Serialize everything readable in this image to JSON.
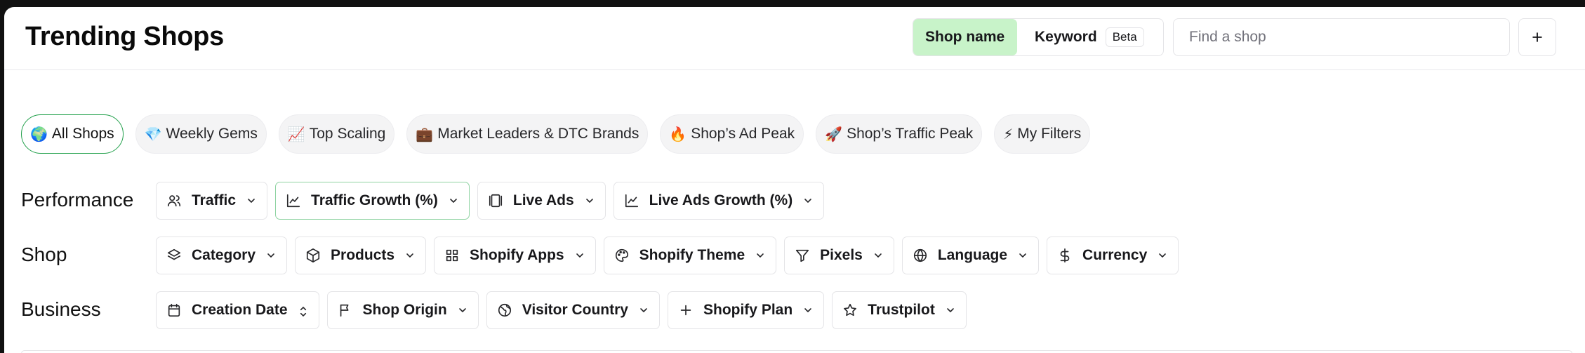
{
  "header": {
    "title": "Trending Shops",
    "search_mode": {
      "shop_name": "Shop name",
      "keyword": "Keyword",
      "beta_badge": "Beta"
    },
    "search": {
      "placeholder": "Find a shop",
      "value": ""
    },
    "add_icon": "plus-icon"
  },
  "presets": [
    {
      "emoji": "🌍",
      "label": "All Shops",
      "active": true
    },
    {
      "emoji": "💎",
      "label": "Weekly Gems"
    },
    {
      "emoji": "📈",
      "label": "Top Scaling"
    },
    {
      "emoji": "💼",
      "label": "Market Leaders & DTC Brands"
    },
    {
      "emoji": "🔥",
      "label": "Shop’s Ad Peak"
    },
    {
      "emoji": "🚀",
      "label": "Shop’s Traffic Peak"
    },
    {
      "emoji": "⚡",
      "label": "My Filters"
    }
  ],
  "rows": {
    "performance": {
      "label": "Performance",
      "filters": [
        {
          "label": "Traffic",
          "icon": "users-icon"
        },
        {
          "label": "Traffic Growth (%)",
          "icon": "line-chart-icon",
          "active": true
        },
        {
          "label": "Live Ads",
          "icon": "gallery-icon"
        },
        {
          "label": "Live Ads Growth (%)",
          "icon": "line-chart-icon"
        }
      ]
    },
    "shop": {
      "label": "Shop",
      "filters": [
        {
          "label": "Category",
          "icon": "layers-icon"
        },
        {
          "label": "Products",
          "icon": "box-icon"
        },
        {
          "label": "Shopify Apps",
          "icon": "grid-icon"
        },
        {
          "label": "Shopify Theme",
          "icon": "palette-icon"
        },
        {
          "label": "Pixels",
          "icon": "filter-icon"
        },
        {
          "label": "Language",
          "icon": "globe-icon"
        },
        {
          "label": "Currency",
          "icon": "dollar-icon"
        }
      ]
    },
    "business": {
      "label": "Business",
      "filters": [
        {
          "label": "Creation Date",
          "icon": "calendar-icon",
          "sort": true
        },
        {
          "label": "Shop Origin",
          "icon": "flag-icon"
        },
        {
          "label": "Visitor Country",
          "icon": "earth-icon"
        },
        {
          "label": "Shopify Plan",
          "icon": "plus-icon"
        },
        {
          "label": "Trustpilot",
          "icon": "star-icon"
        }
      ]
    }
  },
  "colors": {
    "active_segment": "#c8f3c9",
    "active_pill_border": "#22a04b",
    "active_filter_border": "#8fd3a2"
  }
}
